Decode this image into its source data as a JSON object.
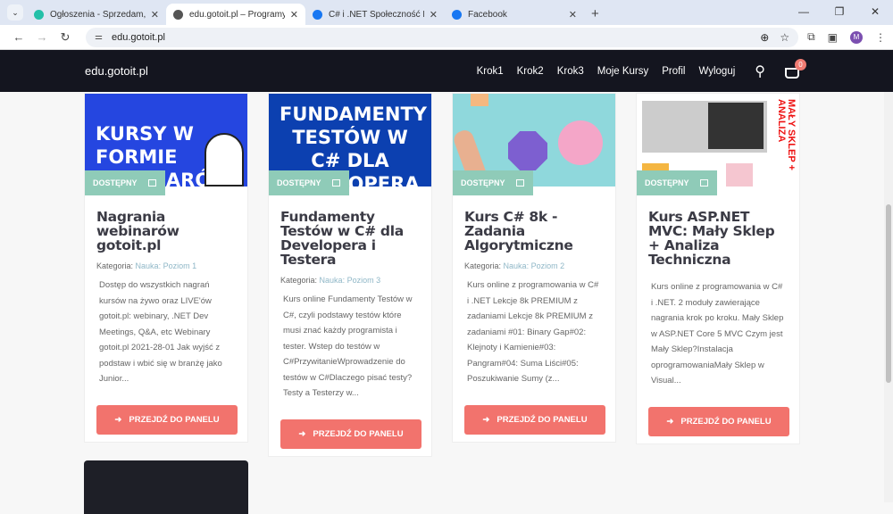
{
  "browser": {
    "tabs": [
      {
        "title": "Ogłoszenia - Sprzedam, kupię",
        "color": "#23c0a8",
        "active": false
      },
      {
        "title": "edu.gotoit.pl – Programy Eduk",
        "color": "#555555",
        "active": true
      },
      {
        "title": "C# i .NET Społeczność Początk",
        "color": "#1877f2",
        "active": false
      },
      {
        "title": "Facebook",
        "color": "#1877f2",
        "active": false
      }
    ],
    "url": "edu.gotoit.pl",
    "avatar": "M"
  },
  "header": {
    "logo": "edu.gotoit.pl",
    "nav": [
      "Krok1",
      "Krok2",
      "Krok3",
      "Moje Kursy",
      "Profil",
      "Wyloguj"
    ],
    "cart_count": "0"
  },
  "cards": [
    {
      "image_text": "KURSY W FORMIE WEBINARÓW",
      "image_bg": "#2546e0",
      "status": "DOSTĘPNY",
      "title": "Nagrania webinarów gotoit.pl",
      "category_label": "Kategoria:",
      "category": "Nauka: Poziom 1",
      "description": "Dostęp do wszystkich nagrań kursów na żywo oraz LIVE'ów gotoit.pl: webinary, .NET Dev Meetings, Q&A, etc Webinary gotoit.pl 2021-28-01 Jak wyjść z podstaw i wbić się w branżę jako Junior...",
      "button": "PRZEJDŹ DO PANELU"
    },
    {
      "image_text": "FUNDAMENTY TESTÓW W C# DLA DEVELOPERA",
      "image_bg": "#0c40b0",
      "status": "DOSTĘPNY",
      "title": "Fundamenty Testów w C# dla Developera i Testera",
      "category_label": "Kategoria:",
      "category": "Nauka: Poziom 3",
      "description": "Kurs online Fundamenty Testów w C#, czyli podstawy testów które musi znać każdy programista i tester. Wstep do testów w C#PrzywitanieWprowadzenie do testów w C#Dlaczego pisać testy? Testy a Testerzy w...",
      "button": "PRZEJDŹ DO PANELU"
    },
    {
      "image_text": "",
      "image_bg": "#8fd8dc",
      "status": "DOSTĘPNY",
      "title": "Kurs C# 8k - Zadania Algorytmiczne",
      "category_label": "Kategoria:",
      "category": "Nauka: Poziom 2",
      "description": "Kurs online z programowania w C# i .NET Lekcje 8k PREMIUM z zadaniami Lekcje 8k PREMIUM z zadaniami #01: Binary Gap#02: Klejnoty i Kamienie#03: Pangram#04: Suma Liści#05: Poszukiwanie Sumy (z...",
      "button": "PRZEJDŹ DO PANELU"
    },
    {
      "image_text": "MAŁY SKLEP + ANALIZA",
      "image_bg": "#ffffff",
      "status": "DOSTĘPNY",
      "title": "Kurs ASP.NET MVC: Mały Sklep + Analiza Techniczna",
      "category_label": "",
      "category": "",
      "description": "Kurs online z programowania w C# i .NET. 2 moduły zawierające nagrania krok po kroku. Mały Sklep w ASP.NET Core 5 MVC Czym jest Mały Sklep?Instalacja oprogramowaniaMały Sklep w Visual...",
      "button": "PRZEJDŹ DO PANELU"
    }
  ]
}
